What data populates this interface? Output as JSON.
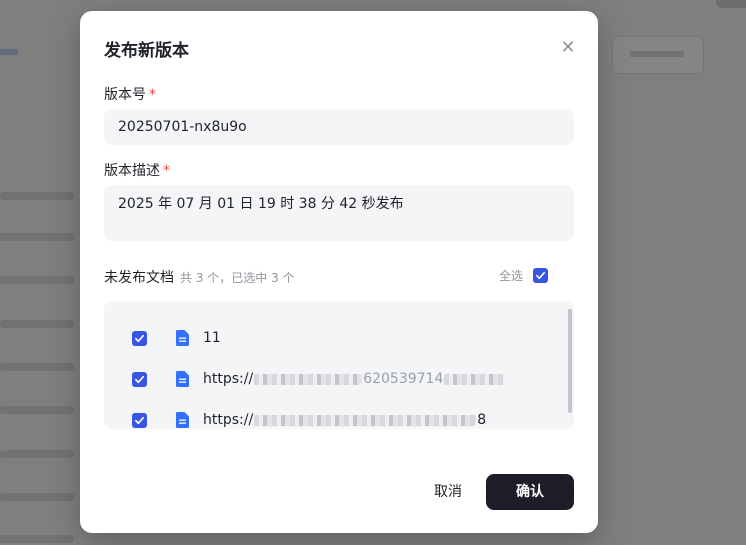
{
  "dialog": {
    "title": "发布新版本",
    "close_icon": "close-icon",
    "version_label": "版本号",
    "required_mark": "*",
    "version_value": "20250701-nx8u9o",
    "desc_label": "版本描述",
    "desc_value": "2025 年 07 月 01 日 19 时 38 分 42 秒发布",
    "list_title": "未发布文档",
    "list_summary": "共 3 个，已选中 3 个",
    "select_all_label": "全选",
    "select_all_checked": true,
    "documents": [
      {
        "name": "11",
        "checked": true,
        "icon": "document-icon"
      },
      {
        "name_prefix": "https://",
        "name_suffix": "",
        "visible_fragment": "620539714",
        "checked": true,
        "icon": "document-icon"
      },
      {
        "name_prefix": "https://",
        "name_suffix": "8",
        "checked": true,
        "icon": "document-icon"
      }
    ],
    "cancel_label": "取消",
    "confirm_label": "确认"
  },
  "colors": {
    "accent": "#3856e3",
    "required": "#f54a45",
    "confirm_bg": "#1c1d27",
    "field_bg": "#f4f5f7",
    "doc_icon": "#3370ff"
  }
}
